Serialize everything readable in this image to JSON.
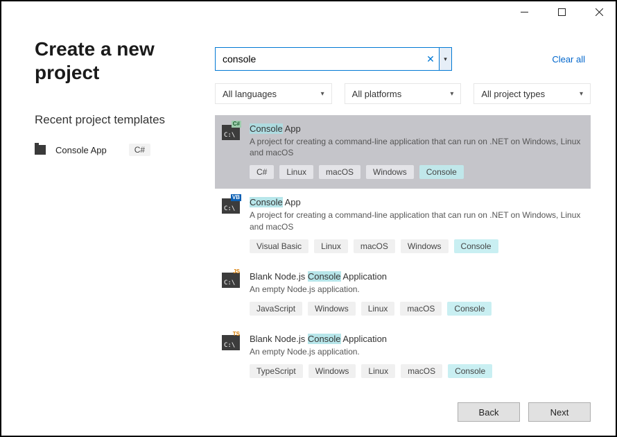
{
  "header": {
    "title": "Create a new project"
  },
  "recent": {
    "heading": "Recent project templates",
    "items": [
      {
        "name": "Console App",
        "language": "C#"
      }
    ]
  },
  "search": {
    "value": "console",
    "clear_all": "Clear all"
  },
  "filters": {
    "language": "All languages",
    "platform": "All platforms",
    "type": "All project types"
  },
  "results": [
    {
      "selected": true,
      "badge": "C#",
      "badge_class": "badge-cs",
      "title_pre": "",
      "title_hl": "Console",
      "title_post": " App",
      "description": "A project for creating a command-line application that can run on .NET on Windows, Linux and macOS",
      "tags": [
        {
          "text": "C#",
          "hl": false
        },
        {
          "text": "Linux",
          "hl": false
        },
        {
          "text": "macOS",
          "hl": false
        },
        {
          "text": "Windows",
          "hl": false
        },
        {
          "text": "Console",
          "hl": true
        }
      ]
    },
    {
      "selected": false,
      "badge": "VB",
      "badge_class": "badge-vb",
      "title_pre": "",
      "title_hl": "Console",
      "title_post": " App",
      "description": "A project for creating a command-line application that can run on .NET on Windows, Linux and macOS",
      "tags": [
        {
          "text": "Visual Basic",
          "hl": false
        },
        {
          "text": "Linux",
          "hl": false
        },
        {
          "text": "macOS",
          "hl": false
        },
        {
          "text": "Windows",
          "hl": false
        },
        {
          "text": "Console",
          "hl": true
        }
      ]
    },
    {
      "selected": false,
      "badge": "JS",
      "badge_class": "badge-js",
      "title_pre": "Blank Node.js ",
      "title_hl": "Console",
      "title_post": " Application",
      "description": "An empty Node.js application.",
      "tags": [
        {
          "text": "JavaScript",
          "hl": false
        },
        {
          "text": "Windows",
          "hl": false
        },
        {
          "text": "Linux",
          "hl": false
        },
        {
          "text": "macOS",
          "hl": false
        },
        {
          "text": "Console",
          "hl": true
        }
      ]
    },
    {
      "selected": false,
      "badge": "TS",
      "badge_class": "badge-ts",
      "title_pre": "Blank Node.js ",
      "title_hl": "Console",
      "title_post": " Application",
      "description": "An empty Node.js application.",
      "tags": [
        {
          "text": "TypeScript",
          "hl": false
        },
        {
          "text": "Windows",
          "hl": false
        },
        {
          "text": "Linux",
          "hl": false
        },
        {
          "text": "macOS",
          "hl": false
        },
        {
          "text": "Console",
          "hl": true
        }
      ]
    }
  ],
  "footer": {
    "back": "Back",
    "next": "Next"
  }
}
